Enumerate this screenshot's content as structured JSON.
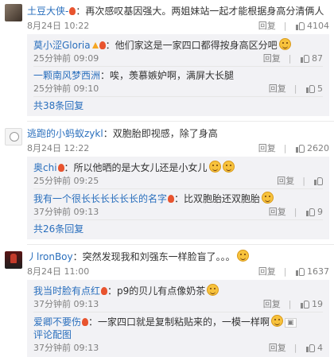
{
  "labels": {
    "reply": "回复",
    "like_sep": "|"
  },
  "comments": [
    {
      "user": "土豆大侠-",
      "text": "：再次感叹基因强大。两姐妹站一起才能根据身高分清俩人",
      "time": "8月24日 10:22",
      "likes": "4104",
      "replies": [
        {
          "user": "莫小涩Gloria",
          "text": "：他们家这是一家四口都得按身高区分吧",
          "time": "25分钟前 09:09",
          "likes": "87"
        },
        {
          "user": "一颗南风梦西洲",
          "text": "：唉，羡慕嫉妒啊，满屏大长腿",
          "time": "25分钟前 09:10",
          "likes": "5"
        }
      ],
      "more": "共38条回复"
    },
    {
      "user": "逃跑的小蚂蚁zykl",
      "text": "：双胞胎即视感，除了身高",
      "time": "8月24日 12:22",
      "likes": "2620",
      "replies": [
        {
          "user": "奥chi",
          "text": "：所以他晒的是大女儿还是小女儿",
          "time": "25分钟前 09:25",
          "likes": ""
        },
        {
          "user": "我有一个很长长长长长长的名字",
          "text": "：比双胞胎还双胞胎",
          "time": "37分钟前 09:13",
          "likes": "9"
        }
      ],
      "more": "共26条回复"
    },
    {
      "user": "丿lronBoy",
      "text": "：突然发现我和刘强东一样脸盲了。。。",
      "time": "8月24日 11:00",
      "likes": "1637",
      "replies": [
        {
          "user": "我当时脸有点红",
          "text": "：p9的贝儿有点像奶茶",
          "time": "37分钟前 09:13",
          "likes": "19"
        },
        {
          "user": "爱卿不要伤",
          "text": "：一家四口就是复制粘贴来的，一模一样啊",
          "extra": "评论配图",
          "time": "37分钟前 09:13",
          "likes": "4"
        }
      ]
    }
  ]
}
